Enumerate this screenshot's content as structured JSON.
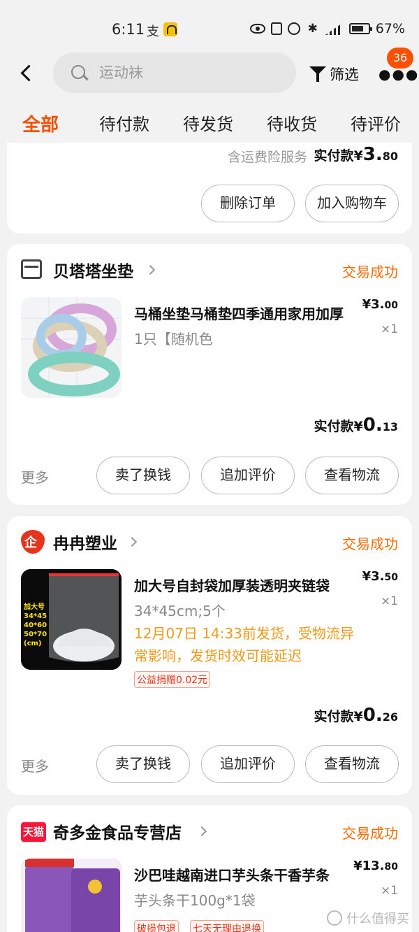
{
  "status_bar": {
    "time": "6:11",
    "alipay": "支",
    "battery": "67%",
    "network": "5G"
  },
  "header": {
    "search_placeholder": "运动袜",
    "filter_label": "筛选",
    "badge_count": "36"
  },
  "tabs": [
    "全部",
    "待付款",
    "待发货",
    "待收货",
    "待评价"
  ],
  "order0": {
    "insurance": "含运费险服务",
    "paid_label": "实付款¥",
    "paid_int": "3.",
    "paid_dec": "80",
    "buttons": [
      "删除订单",
      "加入购物车"
    ]
  },
  "order1": {
    "store": "贝塔塔坐垫",
    "status": "交易成功",
    "title": "马桶坐垫马桶垫四季通用家用加厚",
    "spec": "1只【随机色",
    "price_int": "¥3.",
    "price_dec": "00",
    "qty": "×1",
    "paid_label": "实付款¥",
    "paid_int": "0.",
    "paid_dec": "13",
    "more": "更多",
    "buttons": [
      "卖了换钱",
      "追加评价",
      "查看物流"
    ]
  },
  "order2": {
    "store": "冉冉塑业",
    "status": "交易成功",
    "title": "加大号自封袋加厚装透明夹链袋",
    "spec": "34*45cm;5个",
    "notice": "12月07日 14:33前发货，受物流异常影响，发货时效可能延迟",
    "tag": "公益捐赠0.02元",
    "price_int": "¥3.",
    "price_dec": "50",
    "qty": "×1",
    "paid_label": "实付款¥",
    "paid_int": "0.",
    "paid_dec": "26",
    "more": "更多",
    "buttons": [
      "卖了换钱",
      "追加评价",
      "查看物流"
    ],
    "thumb_text": [
      "加大号",
      "34*45",
      "40*60",
      "50*70",
      "(cm)"
    ]
  },
  "order3": {
    "store": "奇多金食品专营店",
    "store_badge": "天猫",
    "status": "交易成功",
    "title": "沙巴哇越南进口芋头条干香芋条",
    "spec": "芋头条干100g*1袋",
    "price_int": "¥13.",
    "price_dec": "80",
    "qty": "×1",
    "tags": [
      "破损包退",
      "七天无理由退换"
    ]
  },
  "watermark": "什么值得买"
}
